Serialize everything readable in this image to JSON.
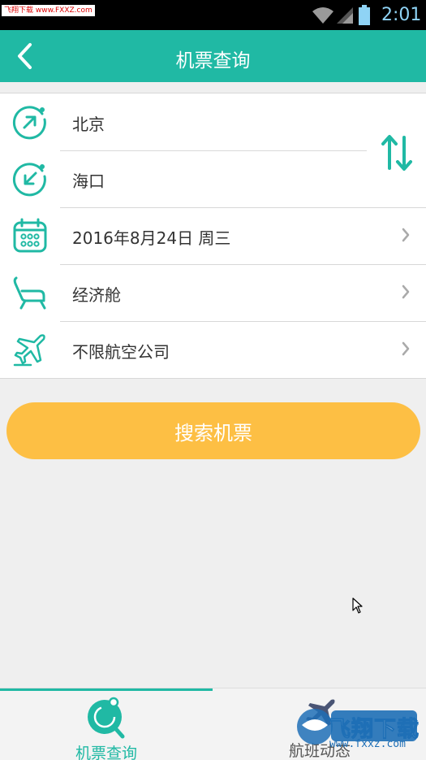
{
  "status_bar": {
    "watermark": "飞翔下载 www.FXXZ.com",
    "time": "2:01"
  },
  "header": {
    "title": "机票查询"
  },
  "form": {
    "departure_city": "北京",
    "arrival_city": "海口",
    "date": "2016年8月24日 周三",
    "cabin_class": "经济舱",
    "airline": "不限航空公司"
  },
  "search_button": {
    "label": "搜索机票"
  },
  "tabs": [
    {
      "label": "机票查询",
      "icon": "search-icon",
      "active": true
    },
    {
      "label": "航班动态",
      "icon": "plane-icon",
      "active": false
    }
  ],
  "watermark_logo": {
    "text": "飞翔下载",
    "url": "www.fxxz.com"
  },
  "colors": {
    "primary": "#20b9a4",
    "accent": "#fdbf44",
    "background": "#efefef"
  }
}
